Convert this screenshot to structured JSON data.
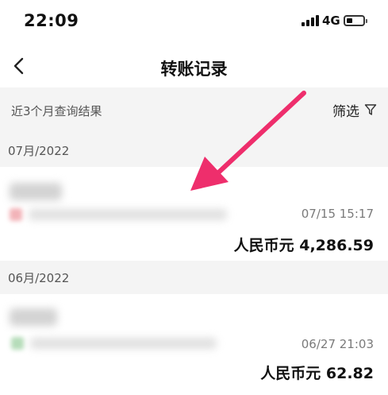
{
  "status_bar": {
    "time": "22:09",
    "network": "4G"
  },
  "nav": {
    "title": "转账记录",
    "back_icon": "chevron-left-icon"
  },
  "filter_bar": {
    "caption": "近3个月查询结果",
    "filter_label": "筛选",
    "filter_icon": "funnel-icon"
  },
  "groups": [
    {
      "month": "07月/2022",
      "record": {
        "time": "07/15 15:17",
        "amount": "人民币元 4,286.59",
        "icon_color": "#f2b3b8"
      }
    },
    {
      "month": "06月/2022",
      "record": {
        "time": "06/27 21:03",
        "amount": "人民币元 62.82",
        "icon_color": "#b5dcb9"
      }
    }
  ],
  "annotation_arrow_color": "#ee2e6c"
}
